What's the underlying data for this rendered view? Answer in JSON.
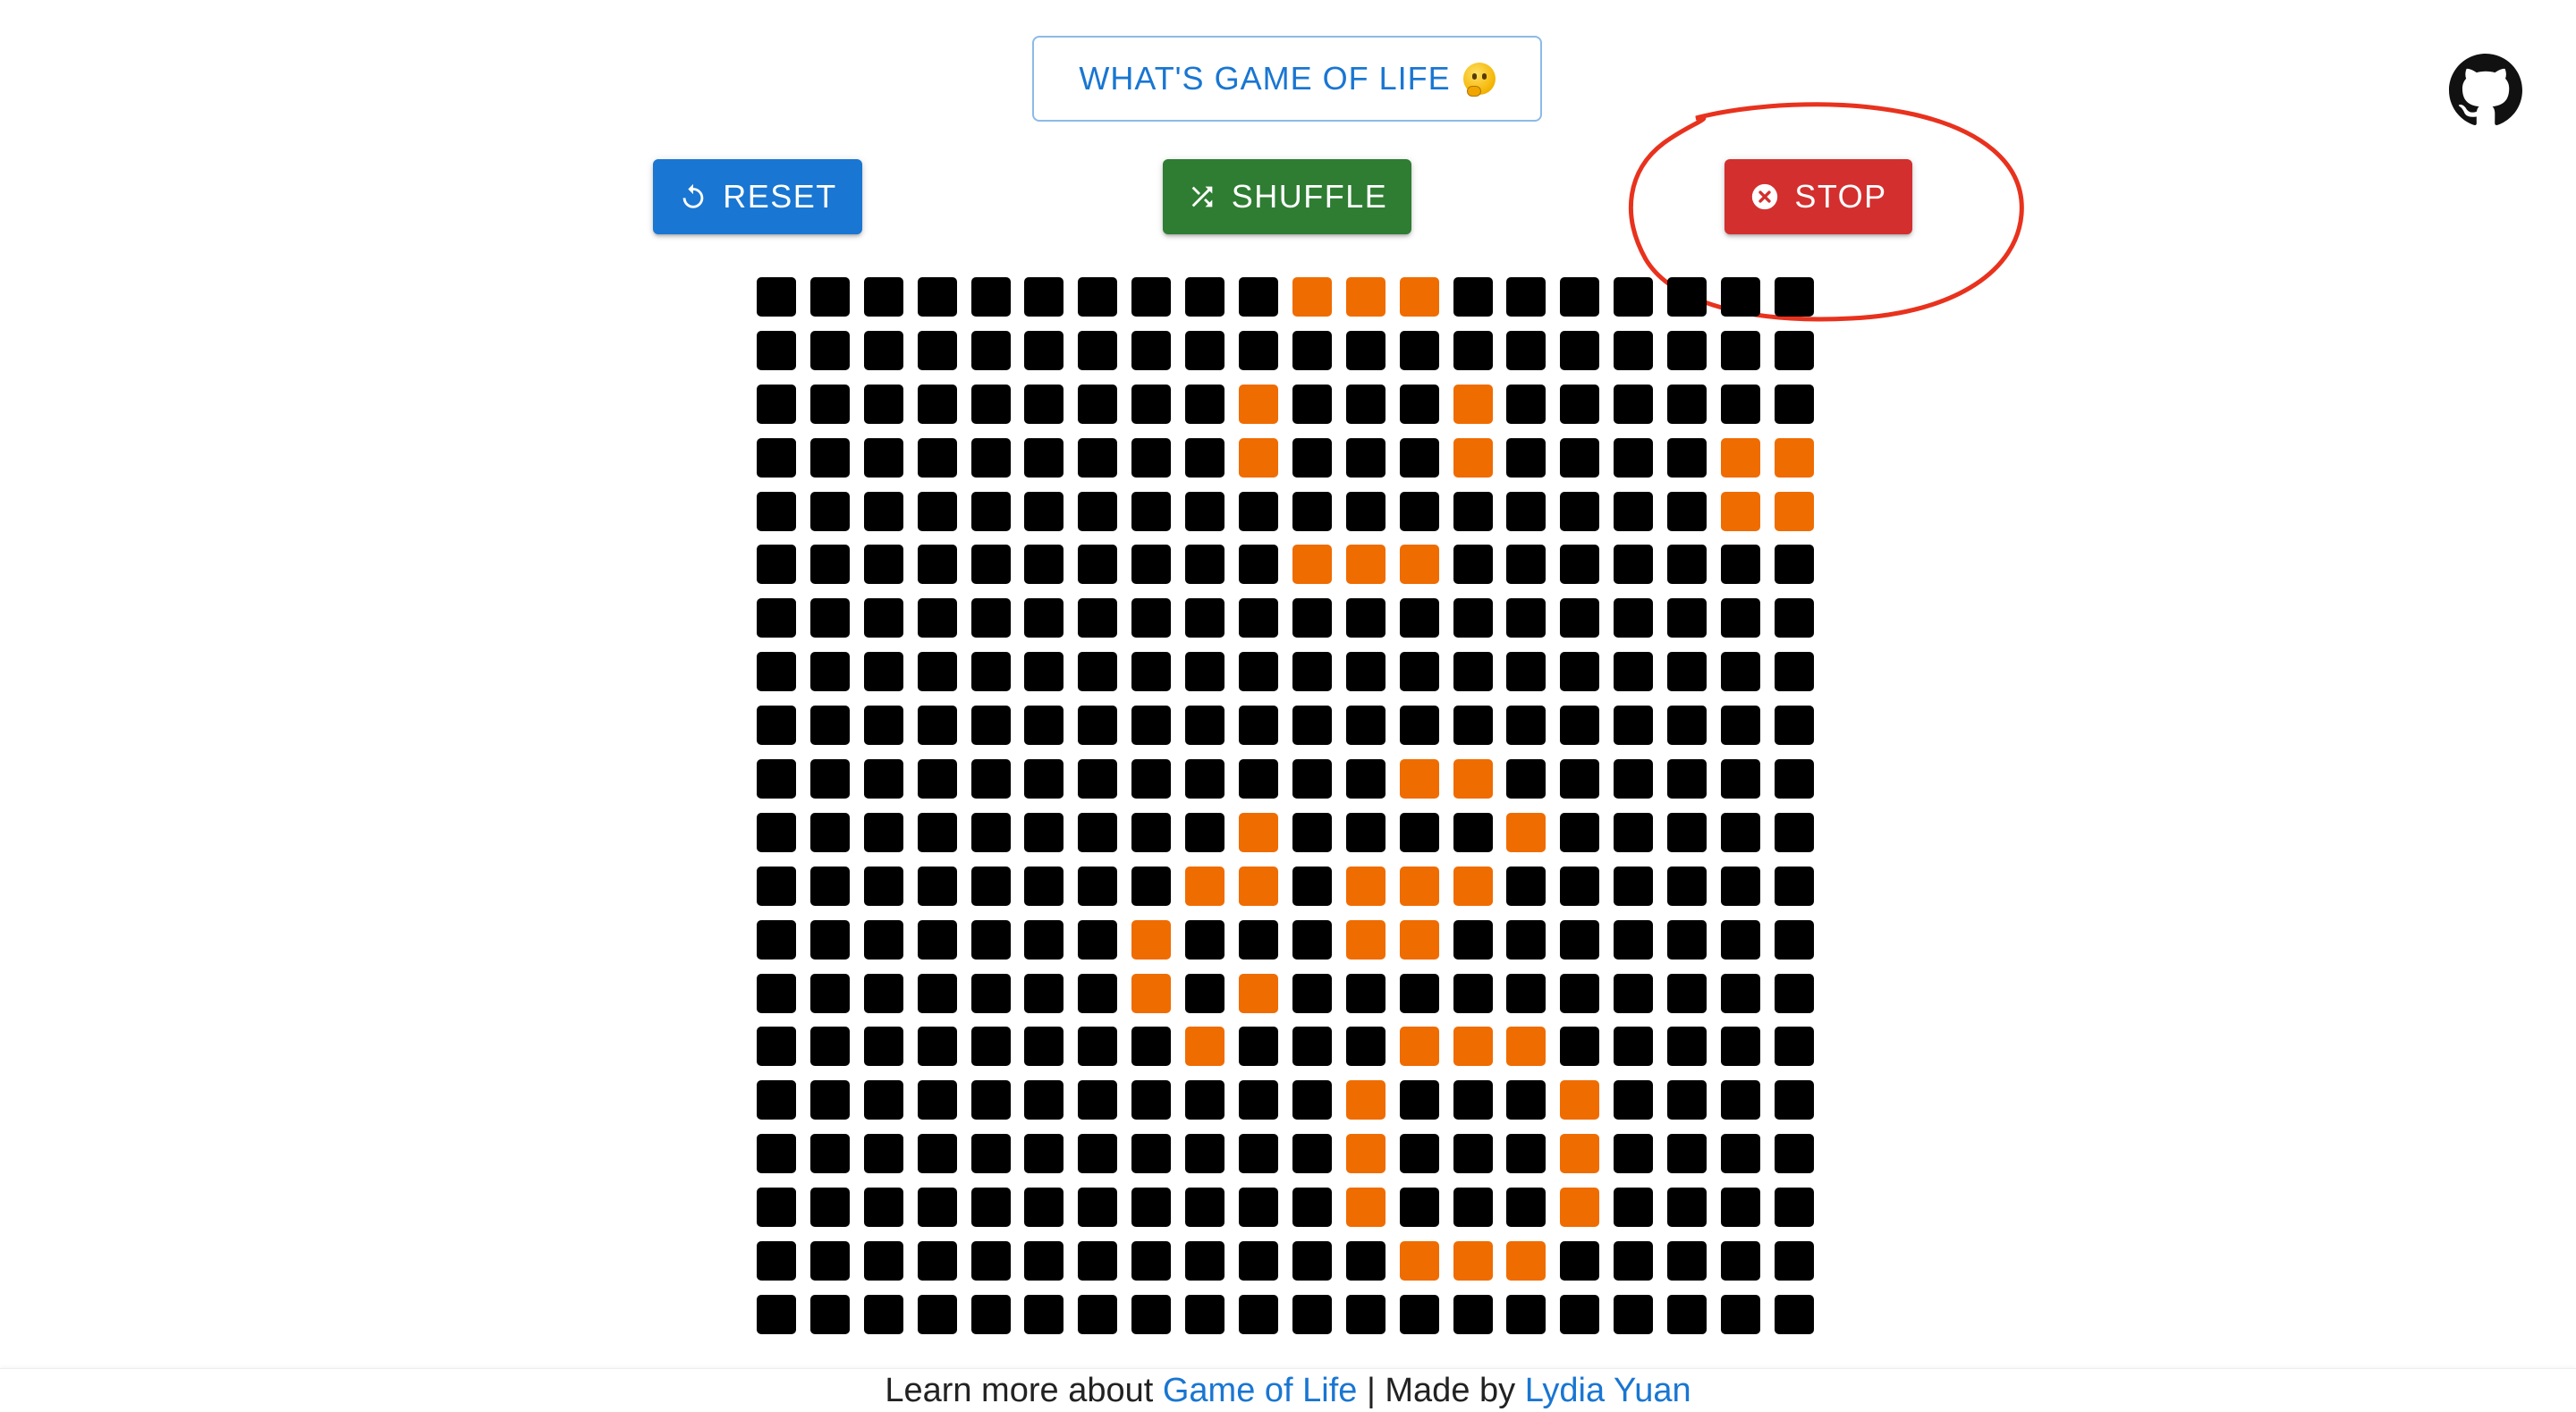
{
  "header": {
    "info_button_label": "WHAT'S GAME OF LIFE",
    "info_button_emoji": "thinking-face-icon"
  },
  "controls": {
    "reset_label": "RESET",
    "reset_icon": "restart-icon",
    "shuffle_label": "SHUFFLE",
    "shuffle_icon": "shuffle-icon",
    "stop_label": "STOP",
    "stop_icon": "cancel-circle-icon"
  },
  "github": {
    "icon": "github-icon"
  },
  "colors": {
    "primary": "#1976d2",
    "success": "#2e7d32",
    "error": "#d32f2f",
    "alive_cell": "#ef6c00",
    "dead_cell": "#000000",
    "annotation": "#e8321e"
  },
  "board": {
    "rows": 20,
    "cols": 20,
    "alive_cells": [
      [
        0,
        10
      ],
      [
        0,
        11
      ],
      [
        0,
        12
      ],
      [
        2,
        9
      ],
      [
        2,
        13
      ],
      [
        3,
        9
      ],
      [
        3,
        13
      ],
      [
        3,
        18
      ],
      [
        3,
        19
      ],
      [
        4,
        18
      ],
      [
        4,
        19
      ],
      [
        5,
        10
      ],
      [
        5,
        11
      ],
      [
        5,
        12
      ],
      [
        9,
        12
      ],
      [
        9,
        13
      ],
      [
        10,
        9
      ],
      [
        10,
        14
      ],
      [
        11,
        8
      ],
      [
        11,
        9
      ],
      [
        11,
        11
      ],
      [
        11,
        12
      ],
      [
        11,
        13
      ],
      [
        12,
        7
      ],
      [
        12,
        11
      ],
      [
        12,
        12
      ],
      [
        13,
        7
      ],
      [
        13,
        9
      ],
      [
        14,
        8
      ],
      [
        14,
        12
      ],
      [
        14,
        13
      ],
      [
        14,
        14
      ],
      [
        15,
        11
      ],
      [
        15,
        15
      ],
      [
        16,
        11
      ],
      [
        16,
        15
      ],
      [
        17,
        11
      ],
      [
        17,
        15
      ],
      [
        18,
        12
      ],
      [
        18,
        13
      ],
      [
        18,
        14
      ]
    ]
  },
  "footer": {
    "prefix": "Learn more about ",
    "game_link": "Game of Life",
    "separator": " | Made by ",
    "author_link": "Lydia Yuan"
  }
}
